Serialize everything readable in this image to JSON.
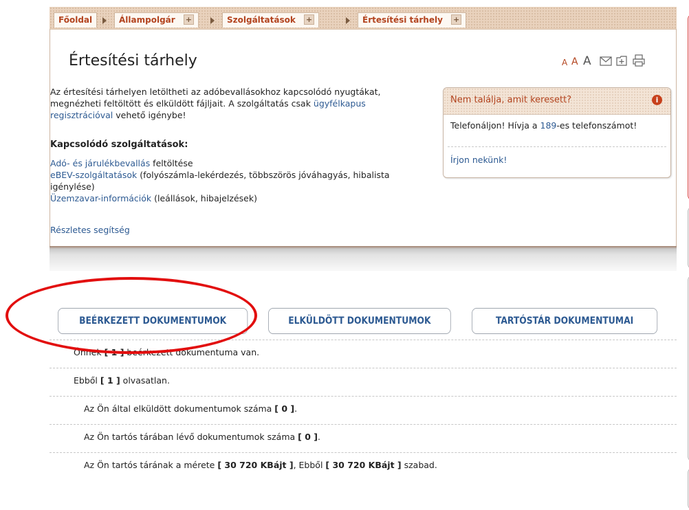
{
  "breadcrumb": {
    "items": [
      {
        "label": "Főoldal"
      },
      {
        "label": "Állampolgár",
        "plus": "+"
      },
      {
        "label": "Szolgáltatások",
        "plus": "+"
      },
      {
        "label": "Értesítési tárhely",
        "plus": "+"
      }
    ]
  },
  "page": {
    "title": "Értesítési tárhely",
    "font_sizes": [
      "A",
      "A",
      "A"
    ]
  },
  "intro": {
    "text1": "Az értesítési tárhelyen letöltheti az adóbevallásokhoz kapcsolódó nyugtákat, megnézheti feltöltött és elküldött fájljait. A szolgáltatás csak ",
    "link": "ügyfélkapus regisztrációval",
    "text2": " vehető igénybe!"
  },
  "related": {
    "heading": "Kapcsolódó szolgáltatások:",
    "items": [
      {
        "link": "Adó- és járulékbevallás",
        "text": " feltöltése"
      },
      {
        "link": "eBEV-szolgáltatások",
        "text": " (folyószámla-lekérdezés, többszörös jóváhagyás, hibalista igénylése)"
      },
      {
        "link": "Üzemzavar-információk",
        "text": " (leállások, hibajelzések)"
      }
    ],
    "help": "Részletes segítség"
  },
  "helpbox": {
    "title": "Nem találja, amit keresett?",
    "info": "i",
    "text_a": "Telefonáljon! Hívja a ",
    "phone": "189",
    "text_b": "-es telefonszámot!",
    "write": "Írjon nekünk!"
  },
  "tabs": [
    {
      "label": "BEÉRKEZETT DOKUMENTUMOK"
    },
    {
      "label": "ELKÜLDÖTT DOKUMENTUMOK"
    },
    {
      "label": "TARTÓSTÁR DOKUMENTUMAI"
    }
  ],
  "rows": [
    {
      "pre": "Önnek ",
      "val": "[ 1 ]",
      "post": " beérkezett dokumentuma van."
    },
    {
      "pre": "Ebből ",
      "val": "[ 1 ]",
      "post": " olvasatlan."
    },
    {
      "pre": "Az Ön által elküldött dokumentumok száma ",
      "val": "[ 0 ]",
      "post": "."
    },
    {
      "pre": "Az Ön tartós tárában lévő dokumentumok száma ",
      "val": "[ 0 ]",
      "post": "."
    },
    {
      "pre": "Az Ön tartós tárának a mérete ",
      "val": "[ 30 720 KBájt ]",
      "mid": ", Ebből ",
      "val2": "[ 30 720 KBájt ]",
      "post": " szabad."
    }
  ],
  "colors": {
    "accent": "#b3441f",
    "link": "#2d5a92",
    "highlight": "#e20e0e"
  }
}
